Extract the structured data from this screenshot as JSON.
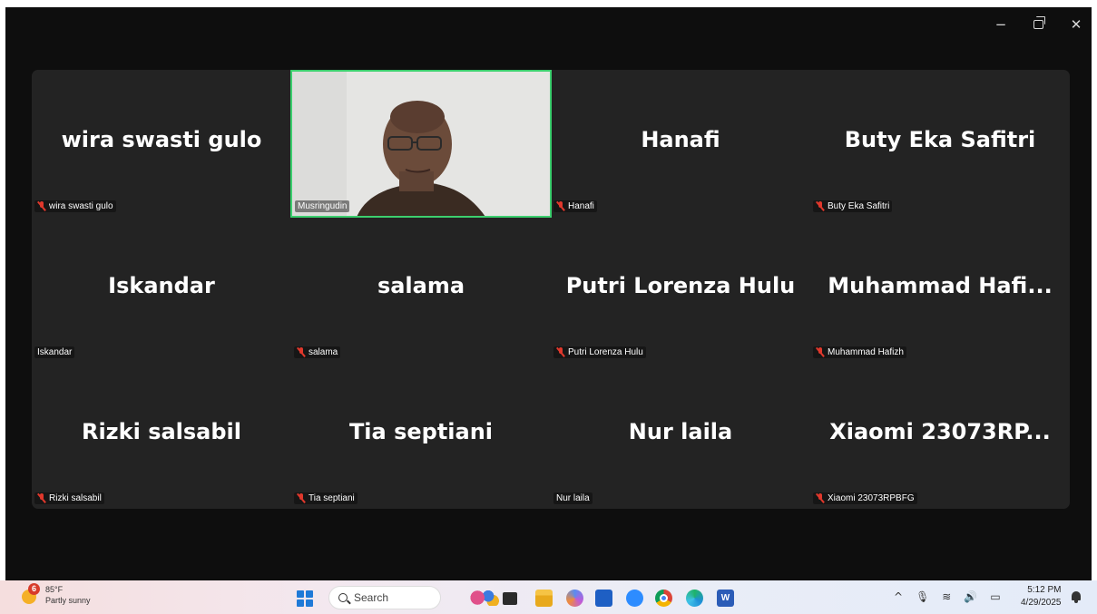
{
  "window": {
    "controls": {
      "minimize": "−",
      "close": "✕"
    }
  },
  "participants": [
    {
      "display_name": "wira swasti gulo",
      "label": "wira swasti gulo",
      "muted": true
    },
    {
      "display_name": "",
      "label": "Musringudin",
      "muted": false,
      "video": true,
      "active_speaker": true
    },
    {
      "display_name": "Hanafi",
      "label": "Hanafi",
      "muted": true
    },
    {
      "display_name": "Buty Eka Safitri",
      "label": "Buty Eka Safitri",
      "muted": true
    },
    {
      "display_name": "Iskandar",
      "label": "Iskandar",
      "muted": false
    },
    {
      "display_name": "salama",
      "label": "salama",
      "muted": true
    },
    {
      "display_name": "Putri Lorenza Hulu",
      "label": "Putri Lorenza Hulu",
      "muted": true
    },
    {
      "display_name": "Muhammad  Hafi...",
      "label": "Muhammad Hafizh",
      "muted": true
    },
    {
      "display_name": "Rizki salsabil",
      "label": "Rizki salsabil",
      "muted": true
    },
    {
      "display_name": "Tia septiani",
      "label": "Tia septiani",
      "muted": true
    },
    {
      "display_name": "Nur laila",
      "label": "Nur laila",
      "muted": false
    },
    {
      "display_name": "Xiaomi  23073RP...",
      "label": "Xiaomi 23073RPBFG",
      "muted": true
    }
  ],
  "taskbar": {
    "weather": {
      "temp": "85°F",
      "condition": "Partly sunny",
      "badge": "6"
    },
    "search_label": "Search",
    "word_letter": "W",
    "tray": {
      "chevron": "^",
      "mic": "🎙",
      "wifi": "≋",
      "volume": "🔊",
      "battery": "▭"
    },
    "time": "5:12 PM",
    "date": "4/29/2025",
    "apps": [
      "widgets-icon",
      "task-view-icon",
      "file-explorer-icon",
      "copilot-icon",
      "mail-icon",
      "zoom-icon",
      "chrome-icon",
      "edge-icon",
      "word-icon"
    ]
  },
  "colors": {
    "active_speaker_border": "#3ccf6e",
    "tile_background": "#232323",
    "muted_icon": "#e0382c"
  }
}
